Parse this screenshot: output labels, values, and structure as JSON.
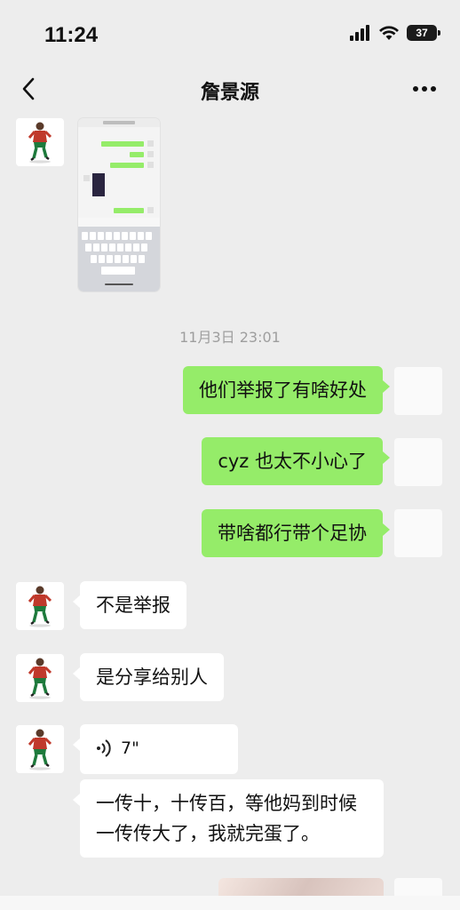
{
  "status": {
    "time": "11:24",
    "battery": "37"
  },
  "nav": {
    "title": "詹景源"
  },
  "timestamp": "11月3日 23:01",
  "messages_out": [
    "他们举报了有啥好处",
    "cyz 也太不小心了",
    "带啥都行带个足协"
  ],
  "messages_in": [
    "不是举报",
    "是分享给别人"
  ],
  "voice": {
    "duration": "7\""
  },
  "long_message": "一传十，十传百，等他妈到时候一传传大了，我就完蛋了。"
}
